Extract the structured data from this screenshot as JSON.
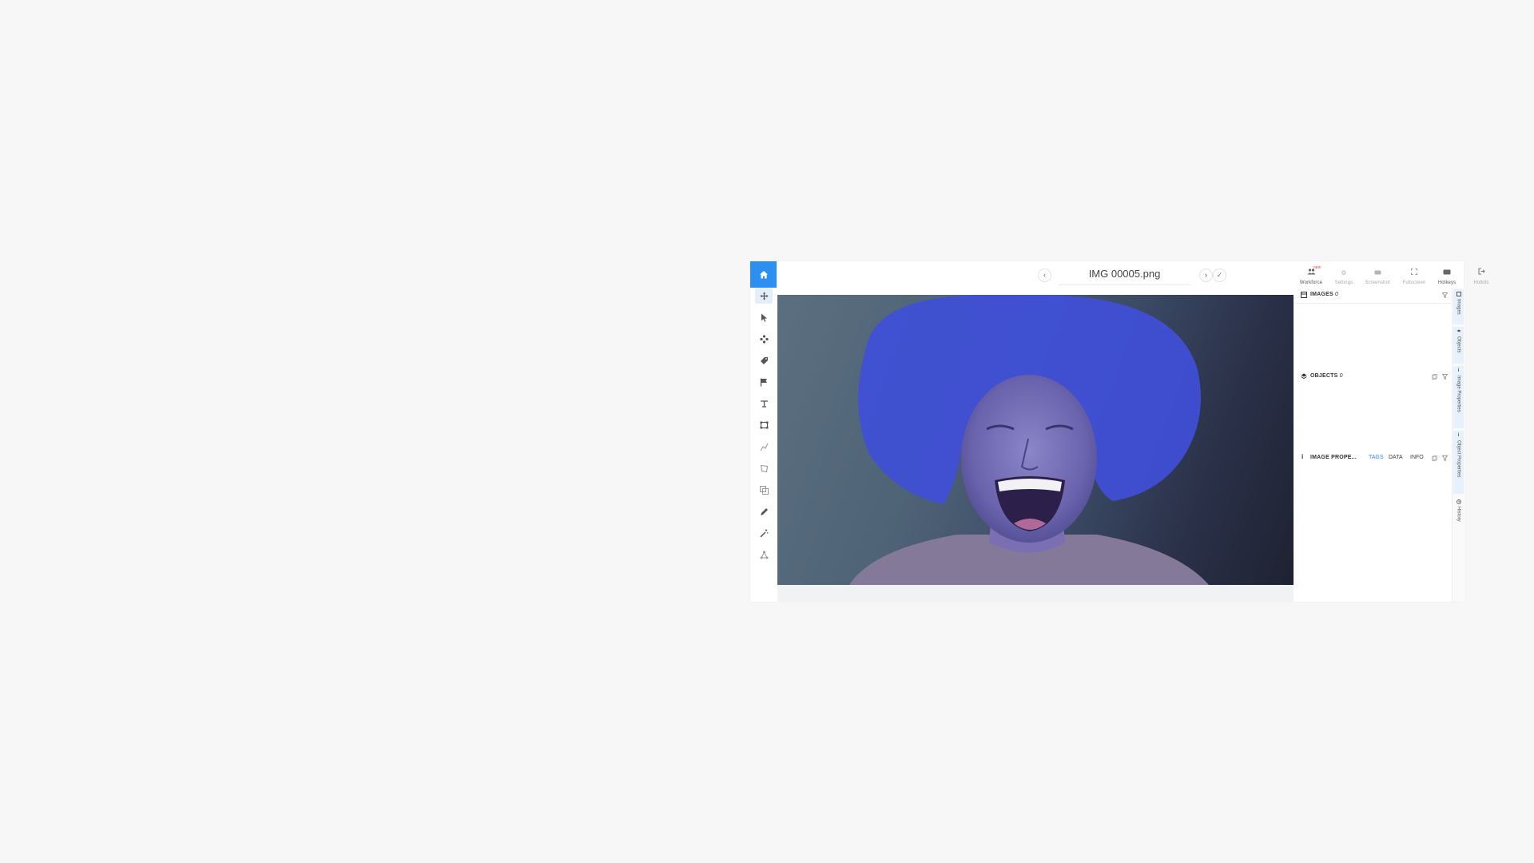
{
  "header": {
    "title": "IMG 00005.png",
    "prev_icon": "chevron-left-icon",
    "next_icon": "chevron-right-icon",
    "confirm_icon": "check-icon",
    "tools": [
      {
        "label": "Workforce",
        "icon": "people-icon",
        "badge": "new",
        "active": true
      },
      {
        "label": "Settings",
        "icon": "gear-icon",
        "active": false
      },
      {
        "label": "Screenshot",
        "icon": "camera-icon",
        "active": false
      },
      {
        "label": "Fullscreen",
        "icon": "fullscreen-icon",
        "active": false
      },
      {
        "label": "Hotkeys",
        "icon": "keyboard-icon",
        "active": true
      },
      {
        "label": "Hotkits",
        "icon": "exit-icon",
        "active": false
      }
    ]
  },
  "toolbar": {
    "tools": [
      "move-icon",
      "pointer-icon",
      "pan-icon",
      "tag-icon",
      "flag-icon",
      "keypoint-icon",
      "rectangle-icon",
      "polyline-icon",
      "polygon-icon",
      "layers-icon",
      "pen-icon",
      "magic-wand-icon",
      "graph-icon"
    ]
  },
  "panel": {
    "images": {
      "label": "IMAGES",
      "count": "0"
    },
    "objects": {
      "label": "OBJECTS",
      "count": "0"
    },
    "image_properties": {
      "label": "IMAGE PROPE...",
      "tabs": [
        "TAGS",
        "DATA",
        "INFO"
      ]
    }
  },
  "rightbar": {
    "items": [
      "Images",
      "Objects",
      "Image Properties",
      "Object Properties",
      "History"
    ]
  },
  "colors": {
    "accent": "#2d8ff0",
    "mask_overlay": "#3f4fd8"
  }
}
